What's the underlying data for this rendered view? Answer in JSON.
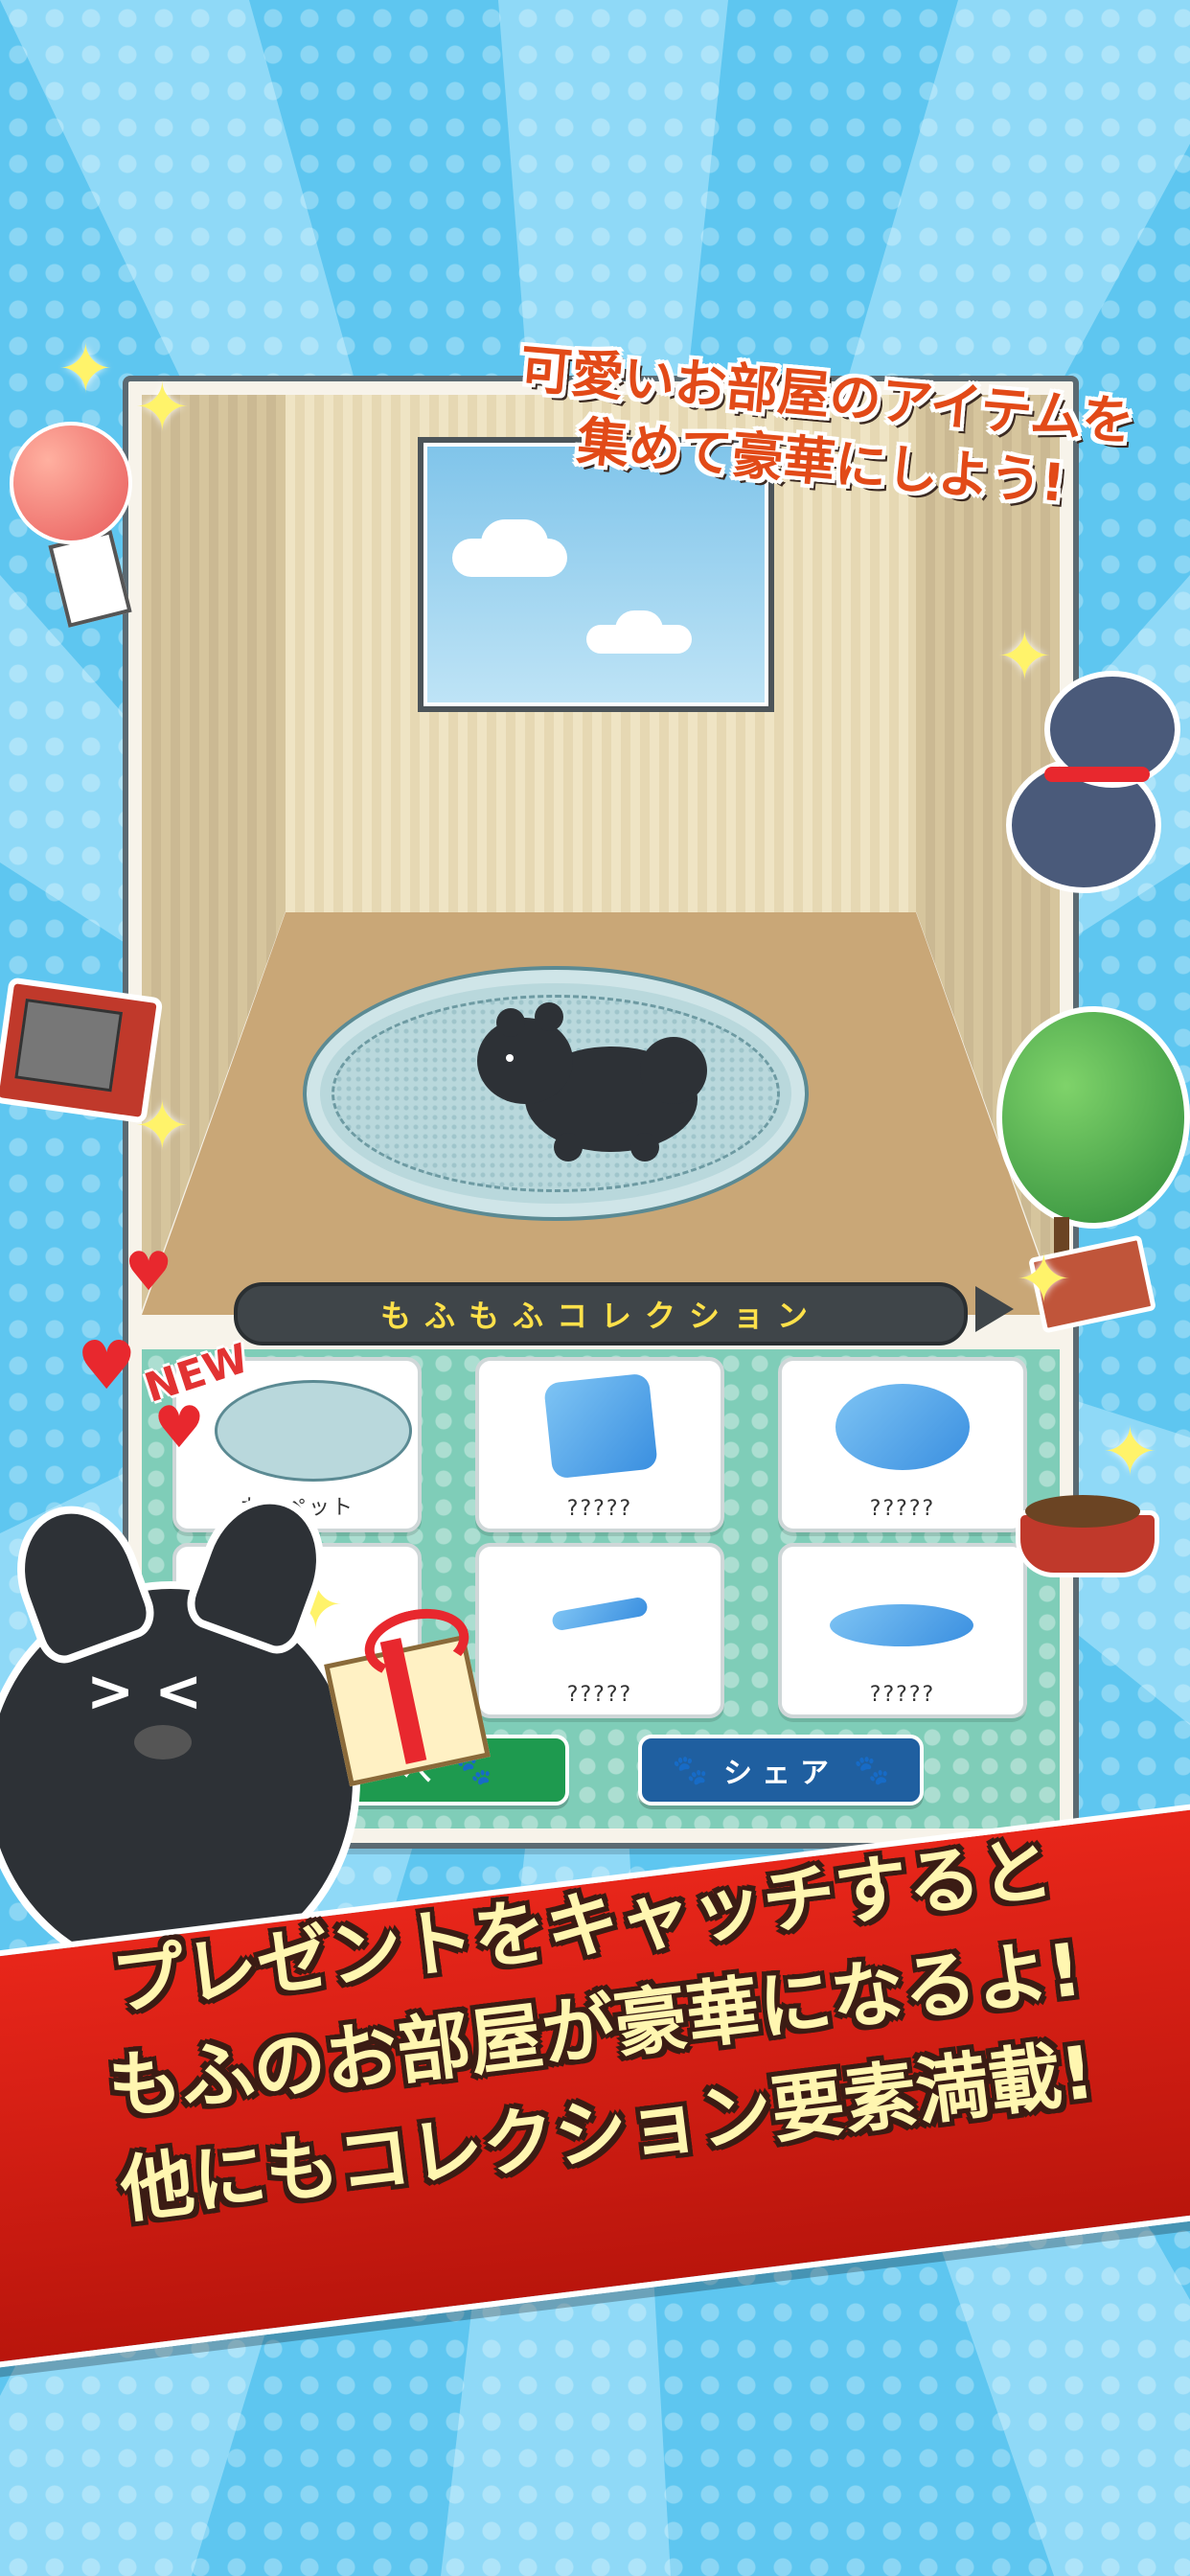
{
  "headline": {
    "line1": "可愛いお部屋のアイテムを",
    "line2": "集めて豪華にしよう!"
  },
  "collection": {
    "title": "もふもふコレクション",
    "new_badge": "NEW",
    "items": [
      {
        "label": "カーペット",
        "icon": "carpet-icon"
      },
      {
        "label": "?????",
        "icon": "cushion-icon"
      },
      {
        "label": "?????",
        "icon": "fluffy-bed-icon"
      },
      {
        "label": "?????",
        "icon": "unknown-item-icon"
      },
      {
        "label": "?????",
        "icon": "bone-toy-icon"
      },
      {
        "label": "?????",
        "icon": "pet-bed-icon"
      }
    ],
    "back_button_label": "へ",
    "share_button_label": "シェア"
  },
  "banner": {
    "line1": "プレゼントをキャッチすると",
    "line2": "もふのお部屋が豪華になるよ!",
    "line3": "他にもコレクション要素満載!"
  },
  "colors": {
    "background": "#5ec6f0",
    "banner": "#e8261a",
    "panel": "#7fcdb8",
    "share_button": "#1f5fa0",
    "back_button": "#1e9a4f",
    "title_text": "#ffe14a"
  }
}
